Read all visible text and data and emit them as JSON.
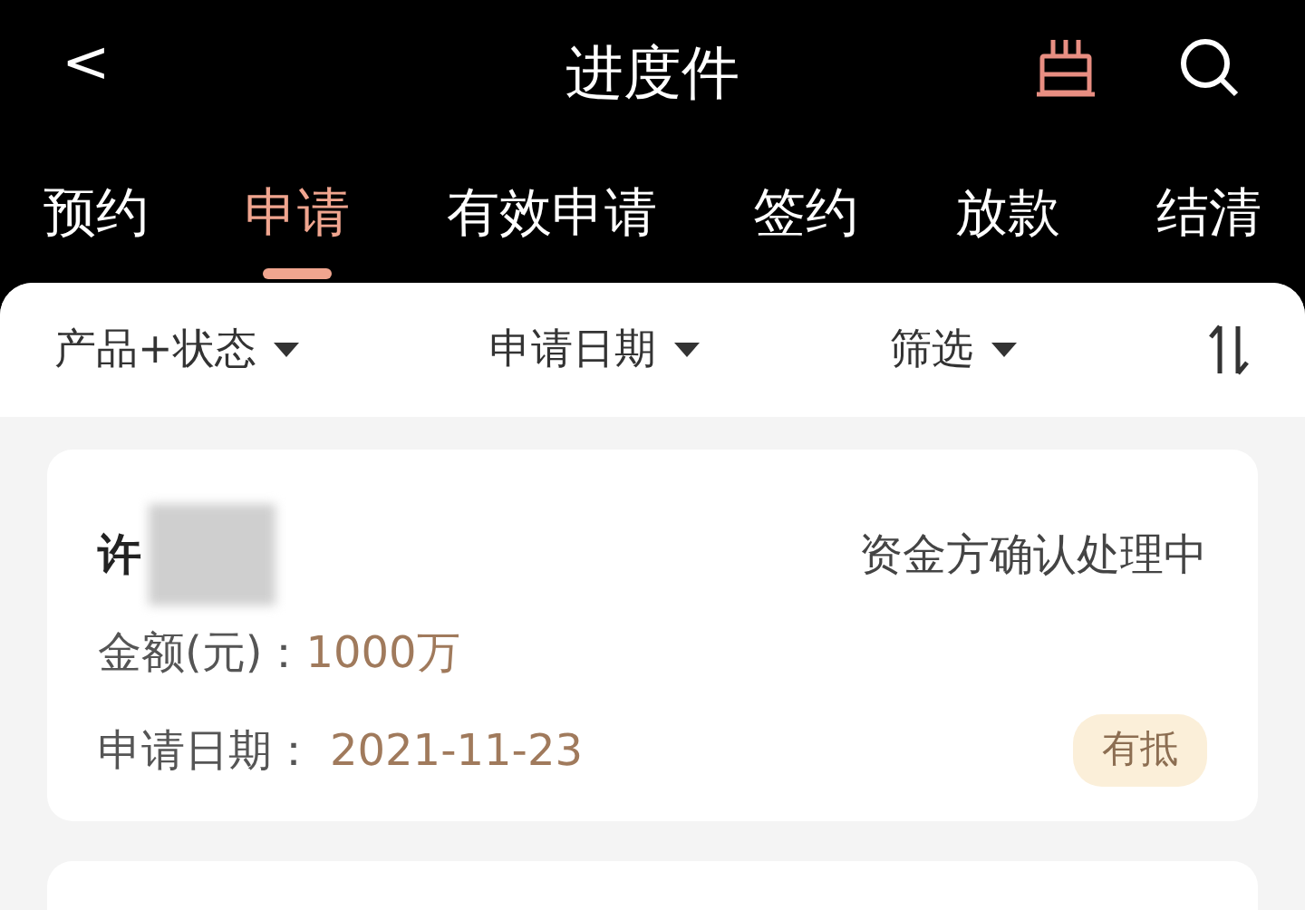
{
  "header": {
    "back": "<",
    "title": "进度件"
  },
  "tabs": [
    {
      "label": "预约",
      "selected": false
    },
    {
      "label": "申请",
      "selected": true
    },
    {
      "label": "有效申请",
      "selected": false
    },
    {
      "label": "签约",
      "selected": false
    },
    {
      "label": "放款",
      "selected": false
    },
    {
      "label": "结清",
      "selected": false
    }
  ],
  "filters": [
    {
      "label": "产品+状态"
    },
    {
      "label": "申请日期"
    },
    {
      "label": "筛选"
    }
  ],
  "cards": [
    {
      "name": "许",
      "status": "资金方确认处理中",
      "amount_label": "金额(元)：",
      "amount": "1000万",
      "date_label": "申请日期：",
      "date": "2021-11-23",
      "tag": "有抵"
    }
  ]
}
